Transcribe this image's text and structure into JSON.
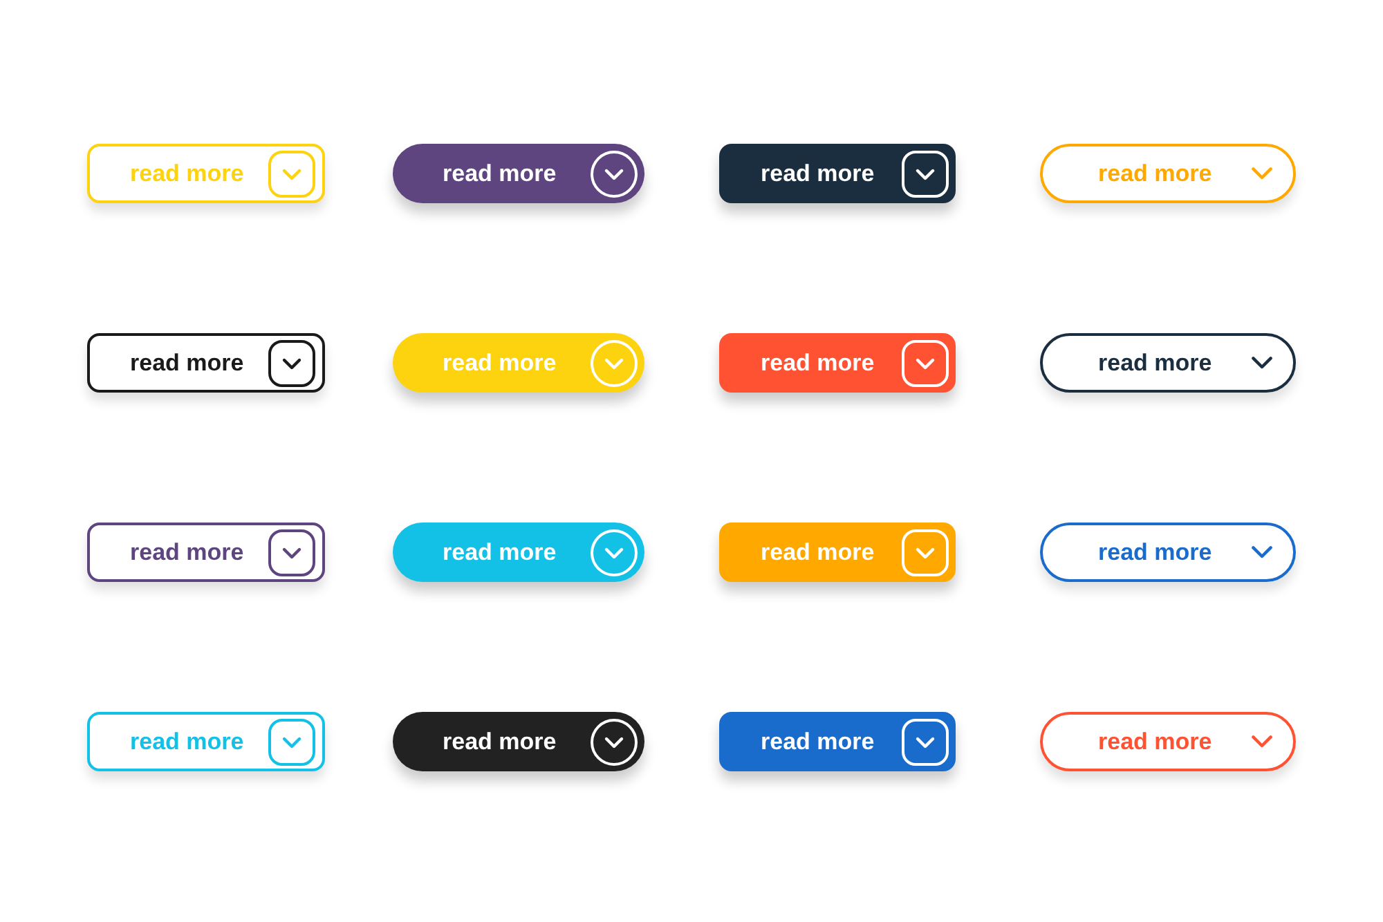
{
  "buttons": [
    {
      "label": "read more",
      "kind": "outline-rounded",
      "color": "#fdd20e"
    },
    {
      "label": "read more",
      "kind": "filled-pill",
      "color": "#5e4580"
    },
    {
      "label": "read more",
      "kind": "filled-rounded",
      "color": "#1a2e40"
    },
    {
      "label": "read more",
      "kind": "outline-pill",
      "color": "#ffa800"
    },
    {
      "label": "read more",
      "kind": "outline-rounded",
      "color": "#1a1a1a"
    },
    {
      "label": "read more",
      "kind": "filled-pill",
      "color": "#fdd20e"
    },
    {
      "label": "read more",
      "kind": "filled-rounded",
      "color": "#ff5233"
    },
    {
      "label": "read more",
      "kind": "outline-pill",
      "color": "#1a2e40"
    },
    {
      "label": "read more",
      "kind": "outline-rounded",
      "color": "#5e4580"
    },
    {
      "label": "read more",
      "kind": "filled-pill",
      "color": "#14c1e6"
    },
    {
      "label": "read more",
      "kind": "filled-rounded",
      "color": "#ffa800"
    },
    {
      "label": "read more",
      "kind": "outline-pill",
      "color": "#1a6ccc"
    },
    {
      "label": "read more",
      "kind": "outline-rounded",
      "color": "#14c1e6"
    },
    {
      "label": "read more",
      "kind": "filled-pill",
      "color": "#222222"
    },
    {
      "label": "read more",
      "kind": "filled-rounded",
      "color": "#1a6ccc"
    },
    {
      "label": "read more",
      "kind": "outline-pill",
      "color": "#ff5233"
    }
  ]
}
